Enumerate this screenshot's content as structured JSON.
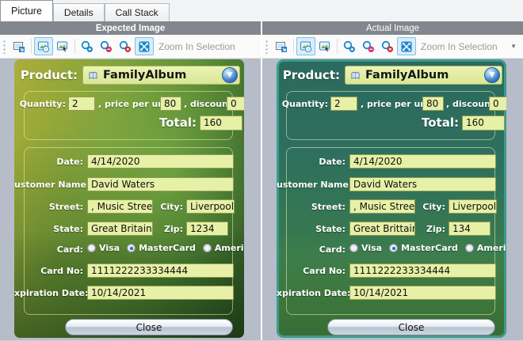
{
  "tabs": {
    "items": [
      {
        "label": "Picture",
        "active": true
      },
      {
        "label": "Details",
        "active": false
      },
      {
        "label": "Call Stack",
        "active": false
      }
    ]
  },
  "toolbar": {
    "zoom_in_selection_label": "Zoom In Selection",
    "icons": [
      "popout-image",
      "pan-image",
      "select-image",
      "zoom-in",
      "zoom-out",
      "zoom-reset",
      "zoom-in-selection",
      "toolbar-overflow"
    ]
  },
  "colors": {
    "panel_header_bg": "#82878d",
    "image_area_bg": "#b6bcc8",
    "toolbar_active_bg": "#d9edf9",
    "accent_blue": "#1f86c9",
    "input_bg": "#e6f0a6",
    "expected_form_base": "#7da33d",
    "actual_form_base": "#2e6f5e",
    "actual_form_border": "#3a9c8d"
  },
  "panels": [
    {
      "header": "Expected Image",
      "form": {
        "product": {
          "label": "Product:",
          "value": "FamilyAlbum"
        },
        "order": {
          "quantity_label": "Quantity:",
          "quantity": "2",
          "price_label": ", price per unit:",
          "price": "80",
          "discount_label": ", discount:",
          "discount": "0",
          "total_label": "Total:",
          "total": "160"
        },
        "customer": {
          "date_label": "Date:",
          "date": "4/14/2020",
          "name_label": "ustomer Name:",
          "name": "David Waters",
          "street_label": "Street:",
          "street": ", Music Street",
          "city_label": "City:",
          "city": "Liverpool",
          "state_label": "State:",
          "state": "Great Britain",
          "zip_label": "Zip:",
          "zip": "1234",
          "card_label": "Card:",
          "card_options": [
            {
              "label": "Visa",
              "selected": false
            },
            {
              "label": "MasterCard",
              "selected": true
            },
            {
              "label": "American Express",
              "selected": false
            }
          ],
          "card_no_label": "Card No:",
          "card_no": "1111222233334444",
          "expiration_label": "xpiration Date:",
          "expiration": "10/14/2021"
        },
        "close_label": "Close"
      }
    },
    {
      "header": "Actual Image",
      "form": {
        "product": {
          "label": "Product:",
          "value": "FamilyAlbum"
        },
        "order": {
          "quantity_label": "Quantity:",
          "quantity": "2",
          "price_label": ", price per unit:",
          "price": "80",
          "discount_label": ", discount:",
          "discount": "0",
          "total_label": "Total:",
          "total": "160"
        },
        "customer": {
          "date_label": "Date:",
          "date": "4/14/2020",
          "name_label": "ustomer Name:",
          "name": "David Waters",
          "street_label": "Street:",
          "street": ", Music Street",
          "city_label": "City:",
          "city": "Liverpool",
          "state_label": "State:",
          "state": "Great Brittain",
          "zip_label": "Zip:",
          "zip": "134",
          "card_label": "Card:",
          "card_options": [
            {
              "label": "Visa",
              "selected": false
            },
            {
              "label": "MasterCard",
              "selected": true
            },
            {
              "label": "American Express",
              "selected": false
            }
          ],
          "card_no_label": "Card No:",
          "card_no": "1111222233334444",
          "expiration_label": "xpiration Date:",
          "expiration": "10/14/2021"
        },
        "close_label": "Close"
      }
    }
  ]
}
